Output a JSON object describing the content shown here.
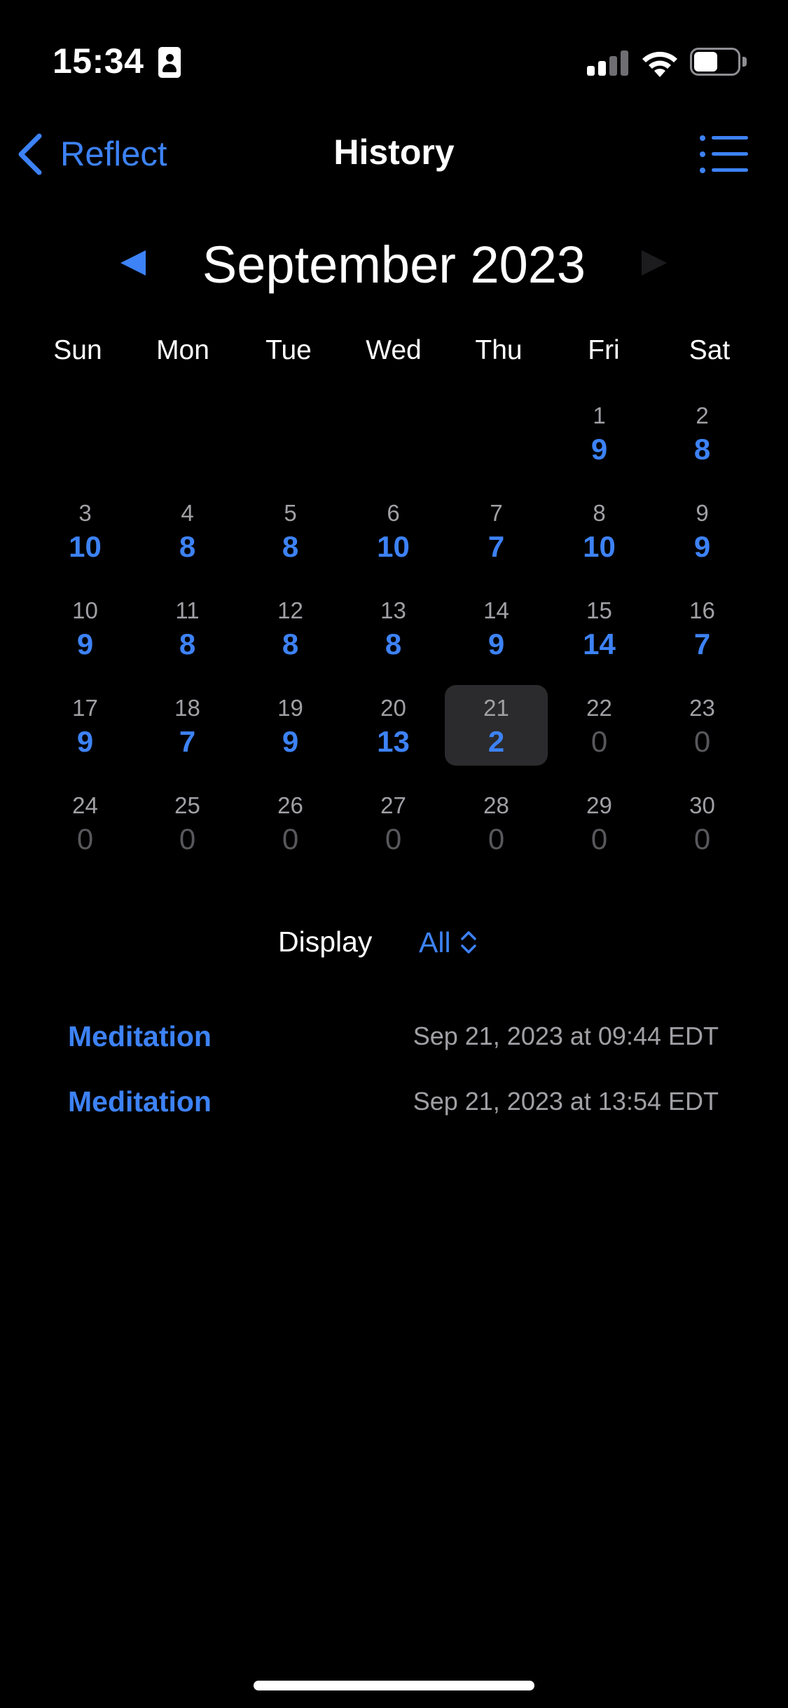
{
  "status_bar": {
    "time": "15:34",
    "contact_icon": "person-card-icon",
    "signal_icon": "cellular-signal-icon",
    "wifi_icon": "wifi-icon",
    "battery_icon": "battery-icon",
    "battery_level": 0.55
  },
  "nav": {
    "back_label": "Reflect",
    "back_icon": "chevron-left-icon",
    "title": "History",
    "menu_icon": "list-icon"
  },
  "month": {
    "title": "September 2023",
    "prev_icon": "triangle-left-icon",
    "next_icon": "triangle-right-icon",
    "next_enabled": false
  },
  "weekdays": [
    "Sun",
    "Mon",
    "Tue",
    "Wed",
    "Thu",
    "Fri",
    "Sat"
  ],
  "calendar": {
    "first_weekday_index": 5,
    "selected_day": 21,
    "days": [
      {
        "day": "1",
        "count": "9"
      },
      {
        "day": "2",
        "count": "8"
      },
      {
        "day": "3",
        "count": "10"
      },
      {
        "day": "4",
        "count": "8"
      },
      {
        "day": "5",
        "count": "8"
      },
      {
        "day": "6",
        "count": "10"
      },
      {
        "day": "7",
        "count": "7"
      },
      {
        "day": "8",
        "count": "10"
      },
      {
        "day": "9",
        "count": "9"
      },
      {
        "day": "10",
        "count": "9"
      },
      {
        "day": "11",
        "count": "8"
      },
      {
        "day": "12",
        "count": "8"
      },
      {
        "day": "13",
        "count": "8"
      },
      {
        "day": "14",
        "count": "9"
      },
      {
        "day": "15",
        "count": "14"
      },
      {
        "day": "16",
        "count": "7"
      },
      {
        "day": "17",
        "count": "9"
      },
      {
        "day": "18",
        "count": "7"
      },
      {
        "day": "19",
        "count": "9"
      },
      {
        "day": "20",
        "count": "13"
      },
      {
        "day": "21",
        "count": "2"
      },
      {
        "day": "22",
        "count": "0"
      },
      {
        "day": "23",
        "count": "0"
      },
      {
        "day": "24",
        "count": "0"
      },
      {
        "day": "25",
        "count": "0"
      },
      {
        "day": "26",
        "count": "0"
      },
      {
        "day": "27",
        "count": "0"
      },
      {
        "day": "28",
        "count": "0"
      },
      {
        "day": "29",
        "count": "0"
      },
      {
        "day": "30",
        "count": "0"
      }
    ]
  },
  "display": {
    "label": "Display",
    "value": "All",
    "icon": "chevron-up-down-icon"
  },
  "sessions": [
    {
      "name": "Meditation",
      "time": "Sep 21, 2023 at 09:44 EDT"
    },
    {
      "name": "Meditation",
      "time": "Sep 21, 2023 at 13:54 EDT"
    }
  ],
  "colors": {
    "accent": "#3d82f6",
    "background": "#000000",
    "muted_text": "#a0a0a5",
    "zero_count": "#58585c",
    "selected_cell": "#2b2b2d"
  }
}
